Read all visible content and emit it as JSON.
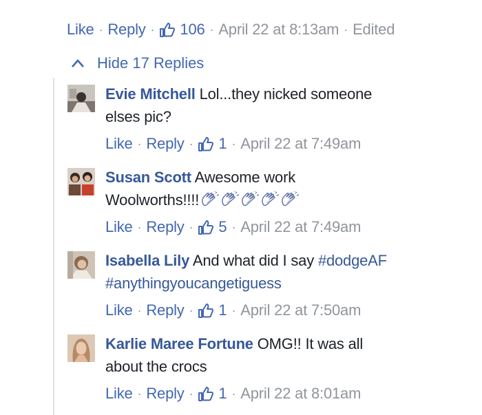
{
  "top_comment": {
    "like_label": "Like",
    "reply_label": "Reply",
    "separator": "·",
    "like_count": "106",
    "timestamp": "April 22 at 8:13am",
    "edited_label": "Edited"
  },
  "hide_replies_label": "Hide 17 Replies",
  "colors": {
    "link": "#4267b2",
    "author": "#365899",
    "meta": "#90949c",
    "thread_line": "#dddfe2"
  },
  "replies": [
    {
      "author": "Evie Mitchell",
      "text_1": "Lol...they nicked someone",
      "text_2": "elses pic?",
      "like_label": "Like",
      "reply_label": "Reply",
      "separator": "·",
      "like_count": "1",
      "timestamp": "April 22 at 7:49am"
    },
    {
      "author": "Susan Scott",
      "text_1": "Awesome work",
      "text_2": "Woolworths!!!!",
      "emoji_icon": "clapping-hands-icon",
      "like_label": "Like",
      "reply_label": "Reply",
      "separator": "·",
      "like_count": "5",
      "timestamp": "April 22 at 7:49am"
    },
    {
      "author": "Isabella Lily",
      "text_1": "And what did I say",
      "hashtag_1": "#dodgeAF",
      "hashtag_2": "#anythingyoucangetiguess",
      "like_label": "Like",
      "reply_label": "Reply",
      "separator": "·",
      "like_count": "1",
      "timestamp": "April 22 at 7:50am"
    },
    {
      "author": "Karlie Maree Fortune",
      "text_1": "OMG!! It was all",
      "text_2": "about the crocs",
      "like_label": "Like",
      "reply_label": "Reply",
      "separator": "·",
      "like_count": "1",
      "timestamp": "April 22 at 8:01am"
    }
  ]
}
